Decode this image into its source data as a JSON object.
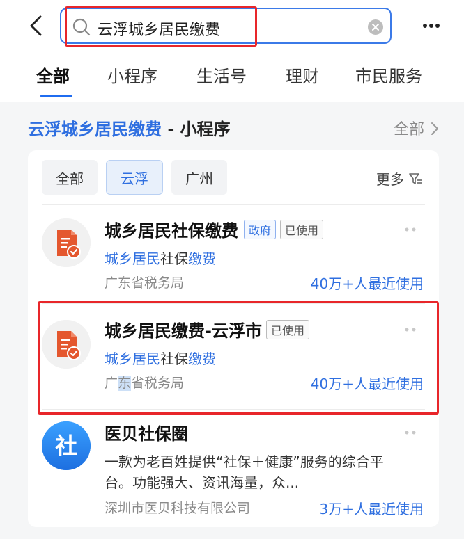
{
  "search": {
    "query": "云浮城乡居民缴费"
  },
  "tabs": [
    {
      "label": "全部"
    },
    {
      "label": "小程序"
    },
    {
      "label": "生活号"
    },
    {
      "label": "理财"
    },
    {
      "label": "市民服务"
    }
  ],
  "section": {
    "title_keyword": "云浮城乡居民缴费",
    "title_suffix": " - 小程序",
    "all_label": "全部"
  },
  "filters": {
    "items": [
      {
        "label": "全部"
      },
      {
        "label": "云浮"
      },
      {
        "label": "广州"
      }
    ],
    "more_label": "更多"
  },
  "results": [
    {
      "title": "城乡居民社保缴费",
      "badges": [
        "政府",
        "已使用"
      ],
      "desc_parts": [
        "城乡居民",
        "社保",
        "缴费"
      ],
      "org": "广东省税务局",
      "usage": "40万+人最近使用"
    },
    {
      "title": "城乡居民缴费-云浮市",
      "badges": [
        "已使用"
      ],
      "desc_parts": [
        "城乡居民",
        "社保",
        "缴费"
      ],
      "org_parts": [
        "广",
        "东",
        "省税务局"
      ],
      "usage": "40万+人最近使用"
    },
    {
      "title": "医贝社保圈",
      "logo_text": "社",
      "desc_line1": "一款为老百姓提供“社保＋健康”服务的综合平",
      "desc_line2": "台。功能强大、资讯海量，众...",
      "org": "深圳市医贝科技有限公司",
      "usage": "3万+人最近使用"
    }
  ],
  "colors": {
    "accent": "#2f6fe0",
    "highlight_box": "#e8262a",
    "muted": "#8a8a8a"
  }
}
